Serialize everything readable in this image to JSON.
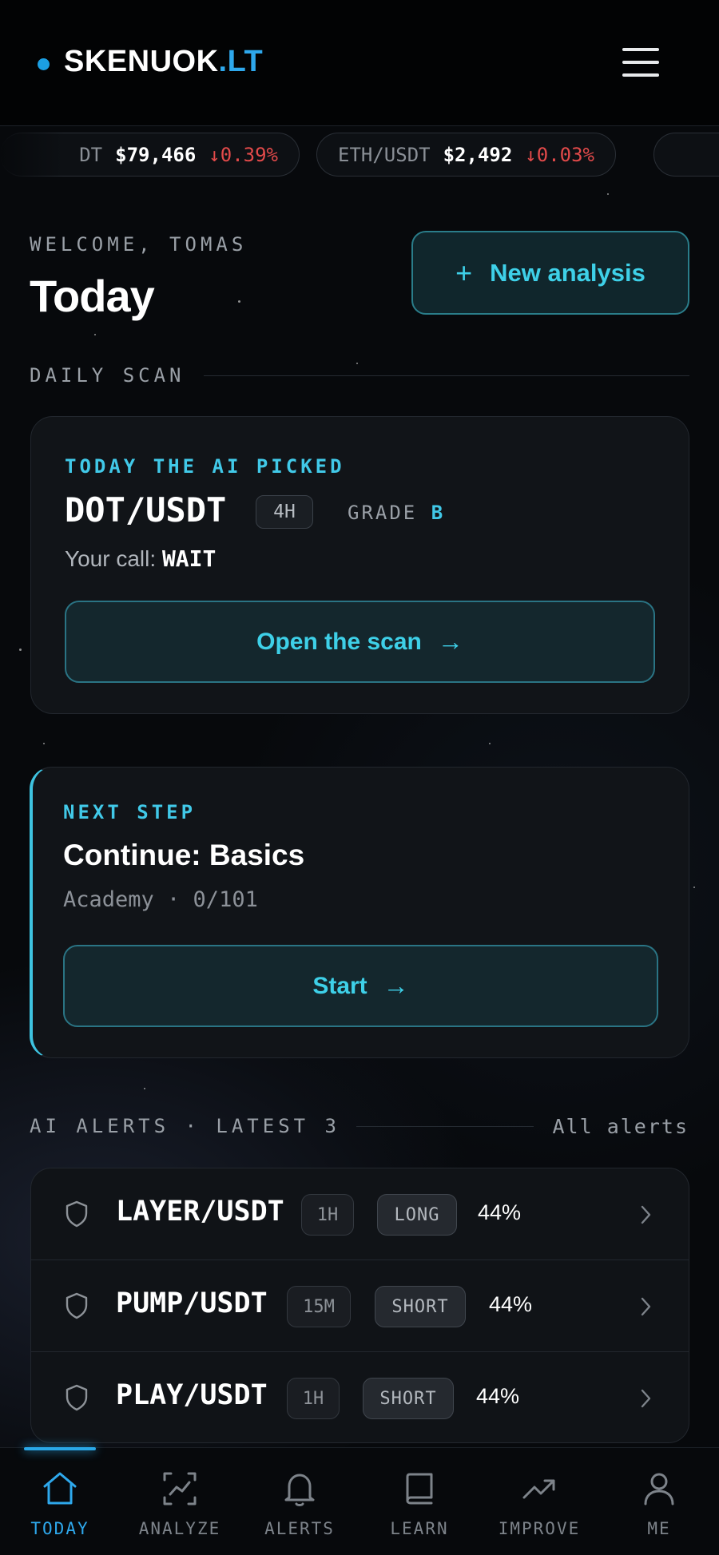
{
  "header": {
    "brand_main": "SKENUOK",
    "brand_accent": ".LT"
  },
  "ticker": [
    {
      "pair": "DT",
      "price": "$79,466",
      "change": "↓0.39%"
    },
    {
      "pair": "ETH/USDT",
      "price": "$2,492",
      "change": "↓0.03%"
    }
  ],
  "welcome": {
    "greeting": "WELCOME, TOMAS",
    "title": "Today",
    "new_analysis_plus": "+",
    "new_analysis_label": "New analysis"
  },
  "daily_scan": {
    "section_label": "DAILY SCAN",
    "kicker": "TODAY THE AI PICKED",
    "pair": "DOT/USDT",
    "timeframe": "4H",
    "grade_label": "GRADE",
    "grade_value": "B",
    "call_label": "Your call:",
    "call_value": "WAIT",
    "button_label": "Open the scan",
    "button_arrow": "→"
  },
  "next_step": {
    "kicker": "NEXT STEP",
    "title": "Continue: Basics",
    "subtitle": "Academy · 0/101",
    "button_label": "Start",
    "button_arrow": "→"
  },
  "alerts": {
    "section_label": "AI ALERTS · LATEST 3",
    "all_label": "All alerts",
    "items": [
      {
        "pair": "LAYER/USDT",
        "timeframe": "1H",
        "direction": "LONG",
        "confidence": "44%"
      },
      {
        "pair": "PUMP/USDT",
        "timeframe": "15M",
        "direction": "SHORT",
        "confidence": "44%"
      },
      {
        "pair": "PLAY/USDT",
        "timeframe": "1H",
        "direction": "SHORT",
        "confidence": "44%"
      }
    ]
  },
  "nav": {
    "active": "TODAY",
    "items": [
      {
        "label": "TODAY",
        "icon": "home-icon"
      },
      {
        "label": "ANALYZE",
        "icon": "chart-scan-icon"
      },
      {
        "label": "ALERTS",
        "icon": "bell-icon"
      },
      {
        "label": "LEARN",
        "icon": "book-icon"
      },
      {
        "label": "IMPROVE",
        "icon": "trending-up-icon"
      },
      {
        "label": "ME",
        "icon": "user-icon"
      }
    ]
  },
  "colors": {
    "accent_cyan": "#3ed0e8",
    "brand_blue": "#2ea8ec",
    "negative_red": "#e24a4a",
    "background": "#07090c"
  }
}
